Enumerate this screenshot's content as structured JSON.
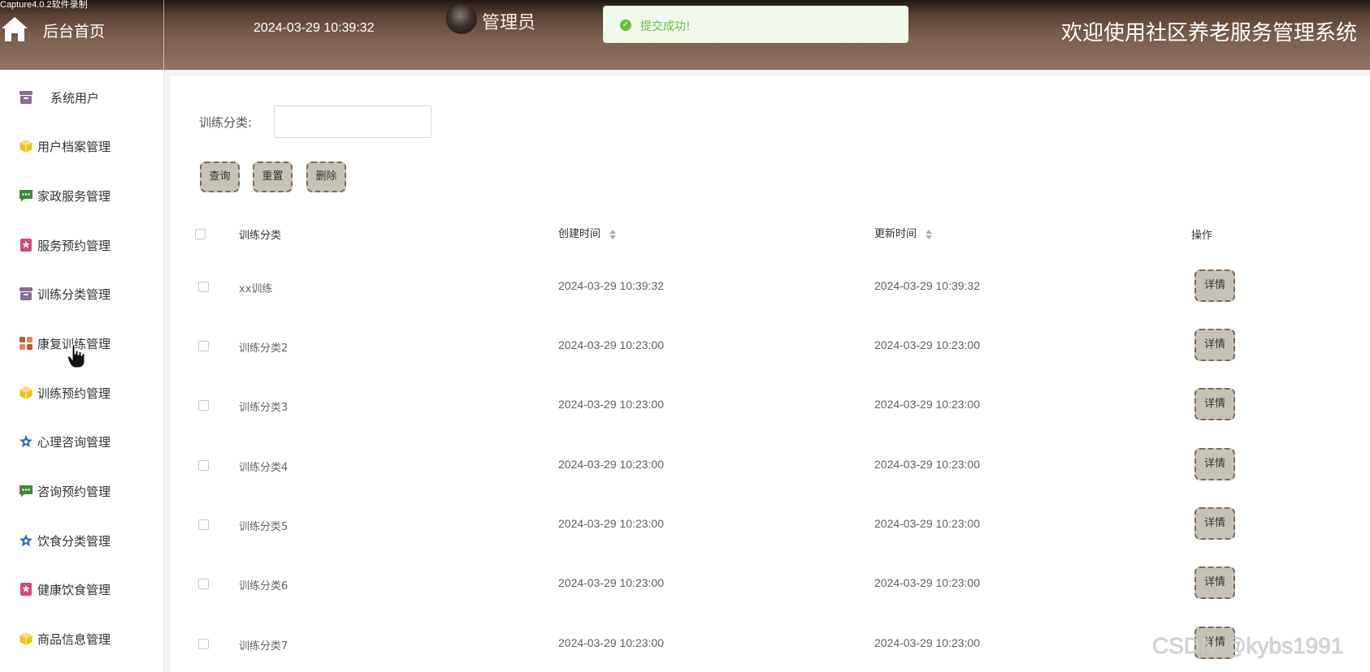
{
  "recorder_tag": "Capture4.0.2软件录制",
  "header": {
    "home_label": "后台首页",
    "datetime": "2024-03-29 10:39:32",
    "username": "管理员",
    "toast": "提交成功!",
    "system_title": "欢迎使用社区养老服务管理系统"
  },
  "sidebar": {
    "items": [
      {
        "label": "系统用户",
        "icon": "archive-icon",
        "color": "#8a6b95"
      },
      {
        "label": "用户档案管理",
        "icon": "cube-icon",
        "color": "#e6c619"
      },
      {
        "label": "家政服务管理",
        "icon": "chat-icon",
        "color": "#3f8a3a"
      },
      {
        "label": "服务预约管理",
        "icon": "badge-icon",
        "color": "#d04a7a"
      },
      {
        "label": "训练分类管理",
        "icon": "archive-icon",
        "color": "#8a6b95"
      },
      {
        "label": "康复训练管理",
        "icon": "grid-icon",
        "color": "#c0553a"
      },
      {
        "label": "训练预约管理",
        "icon": "cube-icon",
        "color": "#e6c619"
      },
      {
        "label": "心理咨询管理",
        "icon": "star-icon",
        "color": "#2f6fd0"
      },
      {
        "label": "咨询预约管理",
        "icon": "chat-icon",
        "color": "#3f8a3a"
      },
      {
        "label": "饮食分类管理",
        "icon": "star-icon",
        "color": "#2f6fd0"
      },
      {
        "label": "健康饮食管理",
        "icon": "badge-icon",
        "color": "#d04a7a"
      },
      {
        "label": "商品信息管理",
        "icon": "cube-icon",
        "color": "#e6c619"
      }
    ]
  },
  "filter": {
    "label": "训练分类:",
    "value": "",
    "placeholder": ""
  },
  "buttons": {
    "query": "查询",
    "reset": "重置",
    "delete": "删除"
  },
  "table": {
    "headers": {
      "name": "训练分类",
      "created": "创建时间",
      "updated": "更新时间",
      "action": "操作"
    },
    "detail_label": "详情",
    "rows": [
      {
        "name": "xx训练",
        "created": "2024-03-29 10:39:32",
        "updated": "2024-03-29 10:39:32"
      },
      {
        "name": "训练分类2",
        "created": "2024-03-29 10:23:00",
        "updated": "2024-03-29 10:23:00"
      },
      {
        "name": "训练分类3",
        "created": "2024-03-29 10:23:00",
        "updated": "2024-03-29 10:23:00"
      },
      {
        "name": "训练分类4",
        "created": "2024-03-29 10:23:00",
        "updated": "2024-03-29 10:23:00"
      },
      {
        "name": "训练分类5",
        "created": "2024-03-29 10:23:00",
        "updated": "2024-03-29 10:23:00"
      },
      {
        "name": "训练分类6",
        "created": "2024-03-29 10:23:00",
        "updated": "2024-03-29 10:23:00"
      },
      {
        "name": "训练分类7",
        "created": "2024-03-29 10:23:00",
        "updated": "2024-03-29 10:23:00"
      }
    ]
  },
  "watermark": "CSDN @kybs1991"
}
